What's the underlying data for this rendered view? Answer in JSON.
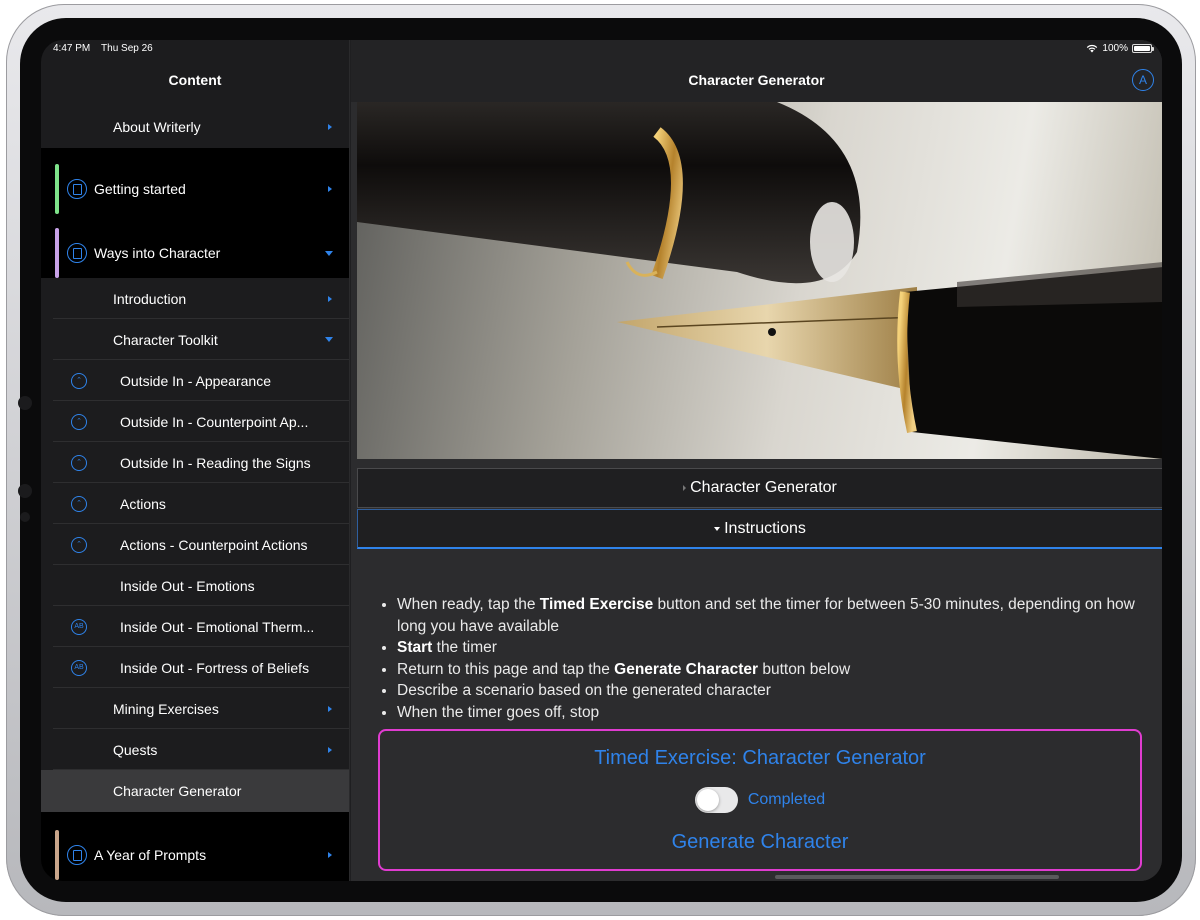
{
  "status": {
    "time": "4:47 PM",
    "date": "Thu Sep 26",
    "battery": "100%",
    "battery_level": 1.0
  },
  "sidebar": {
    "title": "Content",
    "items": [
      {
        "label": "About Writerly",
        "kind": "sub",
        "chevron": "right"
      },
      {
        "label": "Getting started",
        "kind": "section",
        "chevron": "right",
        "accent": "#7ee38a"
      },
      {
        "label": "Ways into Character",
        "kind": "section",
        "chevron": "down",
        "accent": "#c8a2e8"
      },
      {
        "label": "Introduction",
        "kind": "sub",
        "chevron": "right"
      },
      {
        "label": "Character Toolkit",
        "kind": "sub",
        "chevron": "down"
      },
      {
        "label": "Outside In - Appearance",
        "kind": "leaf",
        "icon": "exercise-icon"
      },
      {
        "label": "Outside In - Counterpoint Ap...",
        "kind": "leaf",
        "icon": "exercise-icon"
      },
      {
        "label": "Outside In - Reading the Signs",
        "kind": "leaf",
        "icon": "exercise-icon"
      },
      {
        "label": "Actions",
        "kind": "leaf",
        "icon": "exercise-icon"
      },
      {
        "label": "Actions - Counterpoint Actions",
        "kind": "leaf",
        "icon": "exercise-icon"
      },
      {
        "label": "Inside Out - Emotions",
        "kind": "leaf",
        "icon": ""
      },
      {
        "label": "Inside Out - Emotional Therm...",
        "kind": "leaf",
        "icon": "ab-icon"
      },
      {
        "label": "Inside Out - Fortress of Beliefs",
        "kind": "leaf",
        "icon": "ab-icon"
      },
      {
        "label": "Mining Exercises",
        "kind": "sub",
        "chevron": "right"
      },
      {
        "label": "Quests",
        "kind": "sub",
        "chevron": "right"
      },
      {
        "label": "Character Generator",
        "kind": "sub",
        "selected": true
      },
      {
        "label": "A Year of Prompts",
        "kind": "section",
        "chevron": "right",
        "accent": "#c9a58a"
      }
    ]
  },
  "main": {
    "title": "Character Generator",
    "accordion": [
      {
        "label": "Character Generator",
        "expanded": false
      },
      {
        "label": "Instructions",
        "expanded": true
      }
    ],
    "instructions": [
      [
        "When ready, tap the ",
        "Timed Exercise",
        " button and set the timer for between 5-30 minutes, depending on how long you have available"
      ],
      [
        "",
        "Start",
        " the timer"
      ],
      [
        "Return to this page and tap the ",
        "Generate Character",
        " button below"
      ],
      [
        "Describe a scenario based on the generated character",
        "",
        ""
      ],
      [
        "When the timer goes off, stop",
        "",
        ""
      ]
    ],
    "exercise": {
      "title": "Timed Exercise: Character Generator",
      "toggle_label": "Completed",
      "completed": false,
      "generate_label": "Generate Character"
    }
  },
  "colors": {
    "accent": "#2f83ea",
    "highlight_border": "#e03cd0",
    "sidebar_bg": "#000000",
    "row_bg": "#1c1c1e",
    "selected_row": "#3a3a3c"
  }
}
